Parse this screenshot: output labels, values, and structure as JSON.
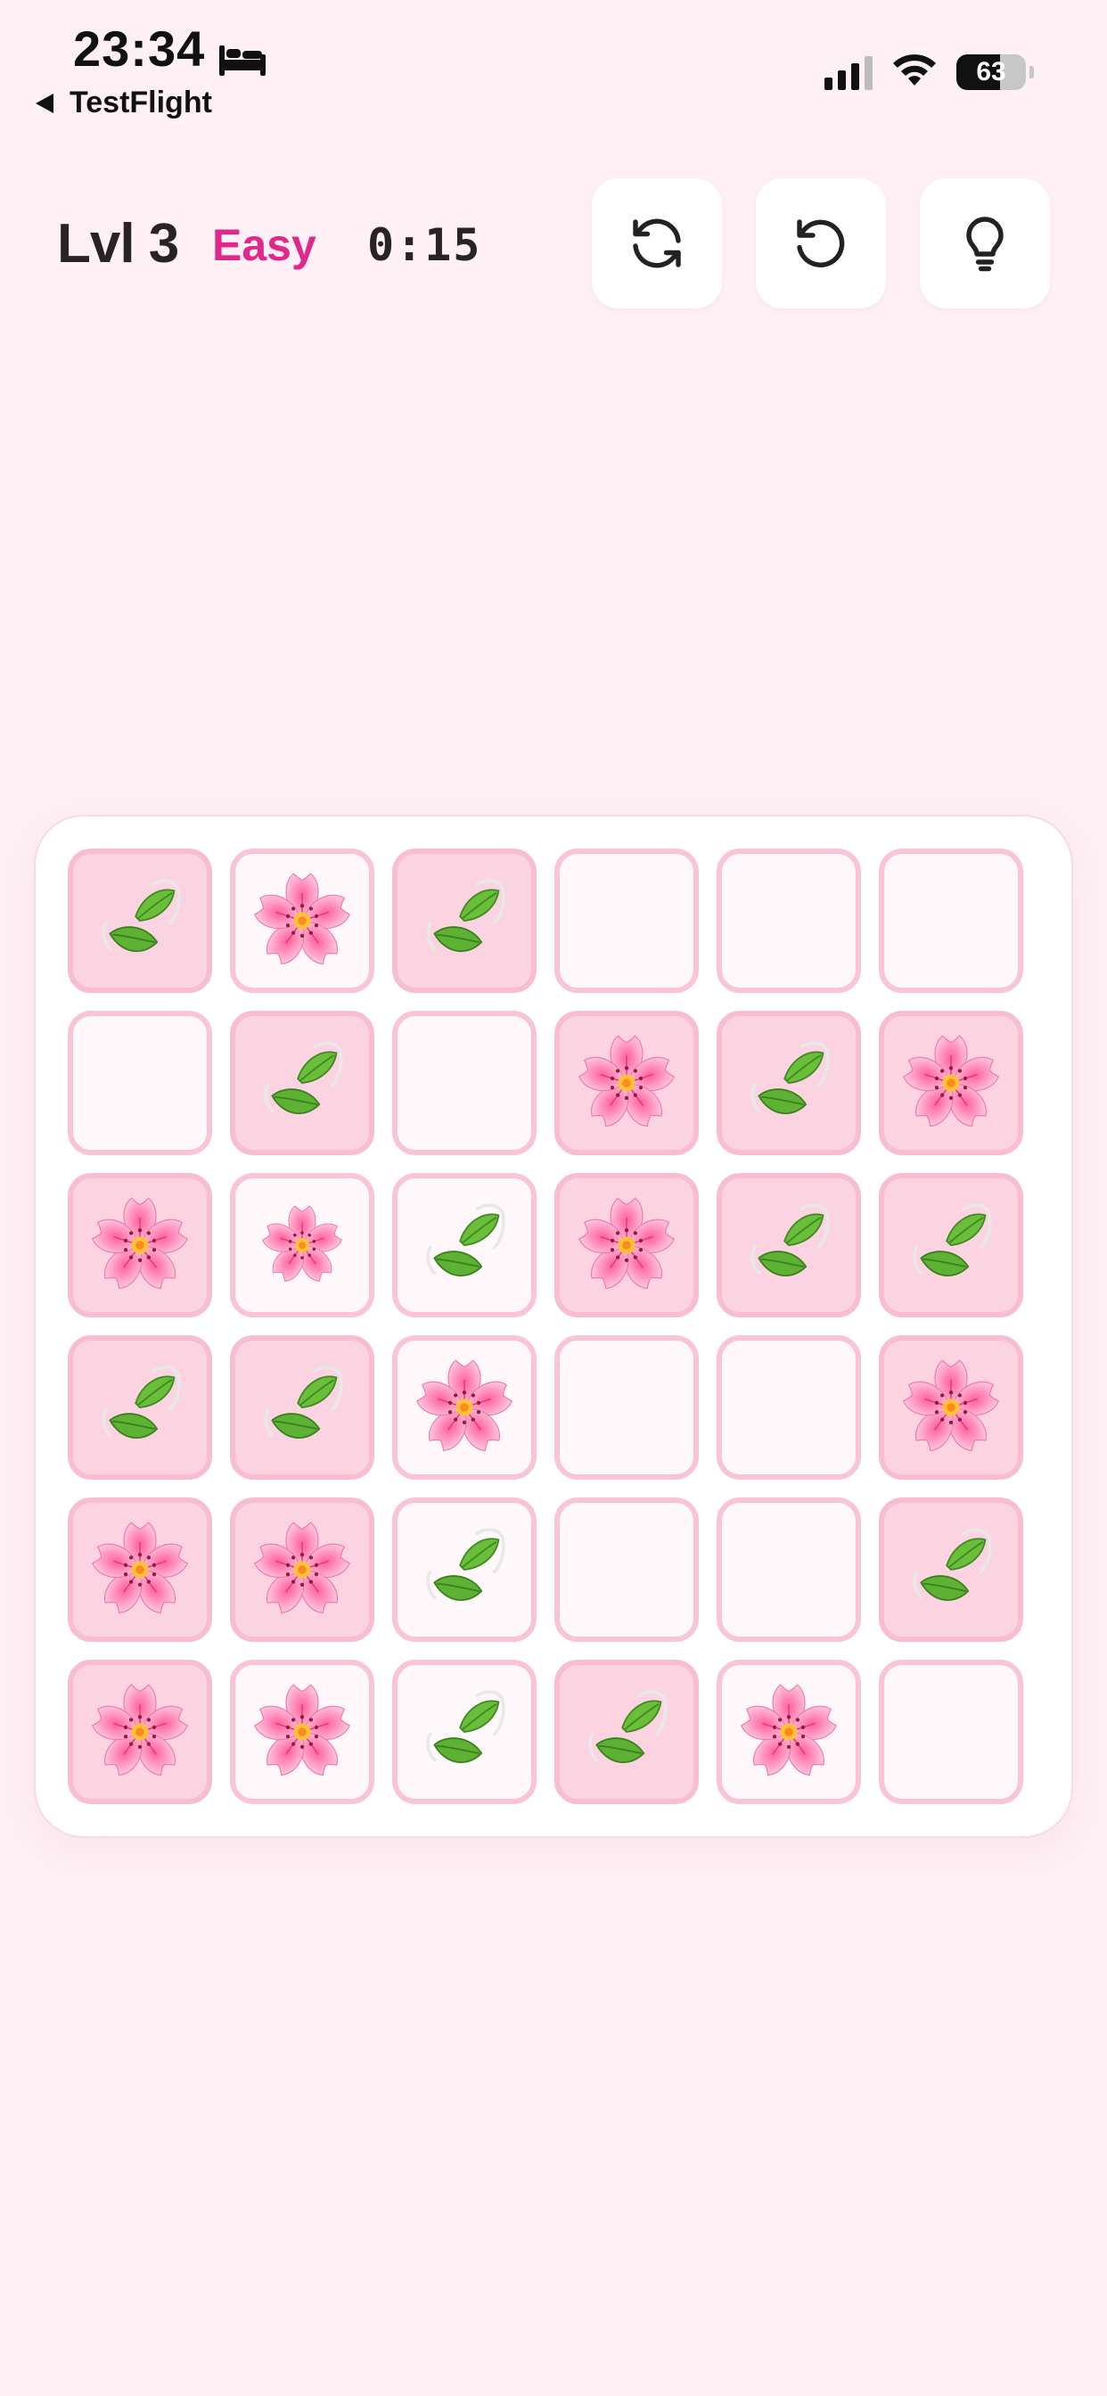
{
  "status_bar": {
    "time": "23:34",
    "back_label": "TestFlight",
    "battery_percent": 63,
    "battery_text": "63",
    "signal_bars_active": 3,
    "signal_bars_total": 4
  },
  "game": {
    "level_label": "Lvl 3",
    "difficulty": "Easy",
    "timer": "0:15"
  },
  "toolbar": {
    "buttons": [
      {
        "name": "refresh-button",
        "icon": "refresh-icon"
      },
      {
        "name": "undo-button",
        "icon": "undo-icon"
      },
      {
        "name": "hint-button",
        "icon": "lightbulb-icon"
      }
    ]
  },
  "colors": {
    "background": "#FEF0F4",
    "accent": "#E0288A",
    "cell_border": "#F9C4D8",
    "cell_fixed_bg": "#FCD3E1",
    "cell_empty_bg": "#FEF8FA",
    "board_bg": "#FFFFFF"
  },
  "board": {
    "rows": 6,
    "cols": 6,
    "cells": [
      [
        {
          "v": "leaf",
          "fixed": true
        },
        {
          "v": "flower",
          "fixed": false
        },
        {
          "v": "leaf",
          "fixed": true
        },
        {
          "v": "empty",
          "fixed": false
        },
        {
          "v": "empty",
          "fixed": false
        },
        {
          "v": "empty",
          "fixed": false
        }
      ],
      [
        {
          "v": "empty",
          "fixed": false
        },
        {
          "v": "leaf",
          "fixed": true
        },
        {
          "v": "empty",
          "fixed": false
        },
        {
          "v": "flower",
          "fixed": true
        },
        {
          "v": "leaf",
          "fixed": true
        },
        {
          "v": "flower",
          "fixed": true
        }
      ],
      [
        {
          "v": "flower",
          "fixed": true
        },
        {
          "v": "flower",
          "fixed": false,
          "small": true
        },
        {
          "v": "leaf",
          "fixed": false
        },
        {
          "v": "flower",
          "fixed": true
        },
        {
          "v": "leaf",
          "fixed": true
        },
        {
          "v": "leaf",
          "fixed": true
        }
      ],
      [
        {
          "v": "leaf",
          "fixed": true
        },
        {
          "v": "leaf",
          "fixed": true
        },
        {
          "v": "flower",
          "fixed": false
        },
        {
          "v": "empty",
          "fixed": false
        },
        {
          "v": "empty",
          "fixed": false
        },
        {
          "v": "flower",
          "fixed": true
        }
      ],
      [
        {
          "v": "flower",
          "fixed": true
        },
        {
          "v": "flower",
          "fixed": true
        },
        {
          "v": "leaf",
          "fixed": false
        },
        {
          "v": "empty",
          "fixed": false
        },
        {
          "v": "empty",
          "fixed": false
        },
        {
          "v": "leaf",
          "fixed": true
        }
      ],
      [
        {
          "v": "flower",
          "fixed": true
        },
        {
          "v": "flower",
          "fixed": false
        },
        {
          "v": "leaf",
          "fixed": false
        },
        {
          "v": "leaf",
          "fixed": true
        },
        {
          "v": "flower",
          "fixed": false
        },
        {
          "v": "empty",
          "fixed": false
        }
      ]
    ]
  }
}
